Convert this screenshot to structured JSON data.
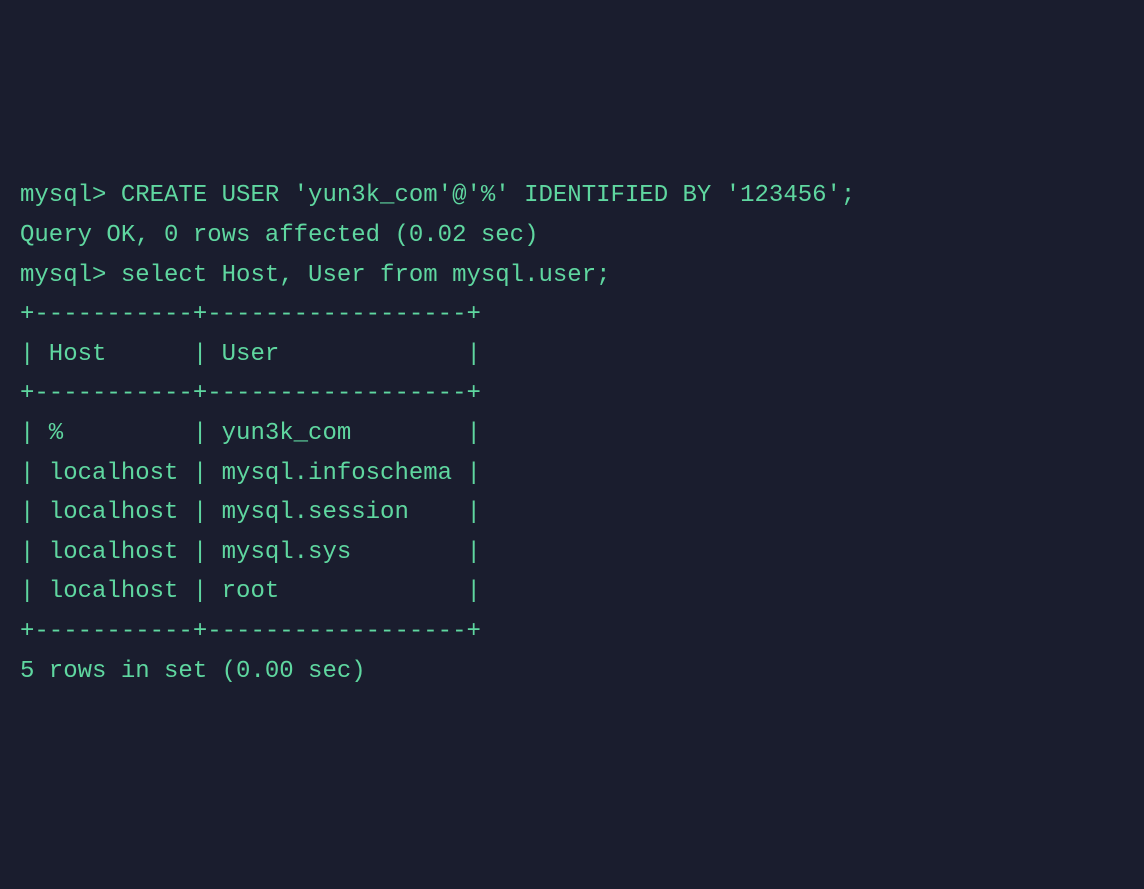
{
  "lines": {
    "l1": "mysql> CREATE USER 'yun3k_com'@'%' IDENTIFIED BY '123456';",
    "l2": "Query OK, 0 rows affected (0.02 sec)",
    "l3": "",
    "l4": "mysql> select Host, User from mysql.user;",
    "l5": "+-----------+------------------+",
    "l6": "| Host      | User             |",
    "l7": "+-----------+------------------+",
    "l8": "| %         | yun3k_com        |",
    "l9": "| localhost | mysql.infoschema |",
    "l10": "| localhost | mysql.session    |",
    "l11": "| localhost | mysql.sys        |",
    "l12": "| localhost | root             |",
    "l13": "+-----------+------------------+",
    "l14": "5 rows in set (0.00 sec)"
  }
}
